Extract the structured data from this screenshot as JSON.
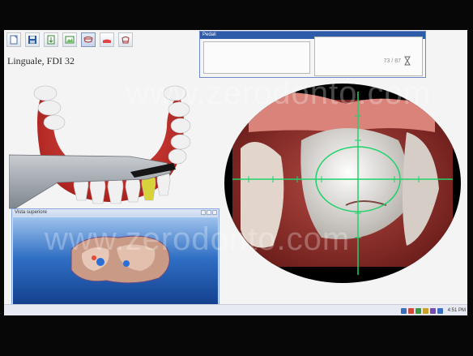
{
  "app": {
    "view_title": "Linguale, FDI 32"
  },
  "toolbar": {
    "buttons": [
      {
        "name": "new-document-icon",
        "color": "#4a6fb3"
      },
      {
        "name": "save-icon",
        "color": "#2c5aa0"
      },
      {
        "name": "export-icon",
        "color": "#3a8a3a"
      },
      {
        "name": "image-icon",
        "color": "#3a8a3a"
      },
      {
        "name": "camera-tool-icon",
        "color": "#a03030"
      },
      {
        "name": "scan-tool-icon",
        "color": "#a03030"
      },
      {
        "name": "crown-tool-icon",
        "color": "#a03030"
      }
    ]
  },
  "pedali": {
    "title": "Pedali",
    "counter": "73 / 87"
  },
  "scan_window": {
    "title": "Vista superiore"
  },
  "taskbar": {
    "clock": "4:51 PM"
  },
  "watermark": {
    "text": "www.zerodonto.com"
  },
  "colors": {
    "gum": "#c8322e",
    "tooth": "#eeeeee",
    "prepared_tooth": "#d7d33a",
    "crosshair": "#1ed36a",
    "scan_bg": "#1f5fb8"
  }
}
